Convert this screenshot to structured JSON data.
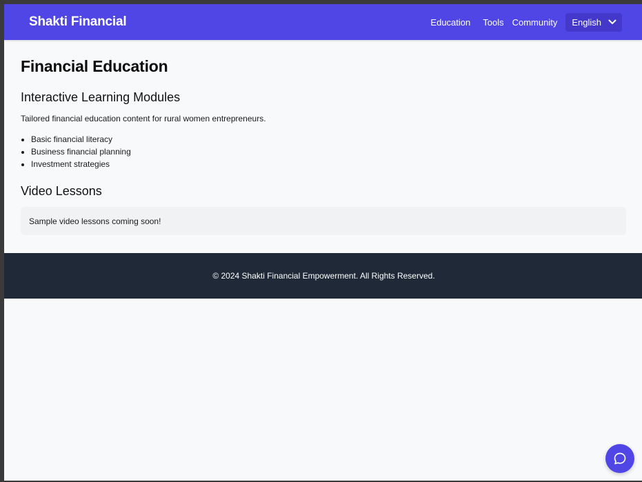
{
  "header": {
    "brand": "Shakti Financial",
    "nav": {
      "education": "Education",
      "tools": "Tools",
      "community": "Community"
    },
    "language": {
      "selected": "English",
      "icon": "chevron-down-icon"
    }
  },
  "main": {
    "title": "Financial Education",
    "modules": {
      "heading": "Interactive Learning Modules",
      "description": "Tailored financial education content for rural women entrepreneurs.",
      "items": [
        "Basic financial literacy",
        "Business financial planning",
        "Investment strategies"
      ]
    },
    "video": {
      "heading": "Video Lessons",
      "notice": "Sample video lessons coming soon!"
    }
  },
  "footer": {
    "text": "© 2024 Shakti Financial Empowerment. All Rights Reserved."
  },
  "chat": {
    "icon": "chat-bubble-icon"
  },
  "colors": {
    "primary": "#4f46e5",
    "primary_dark": "#4338ca",
    "footer_bg": "#1f2937",
    "page_bg": "#f8f9fb",
    "notice_bg": "#f1f2f4"
  }
}
